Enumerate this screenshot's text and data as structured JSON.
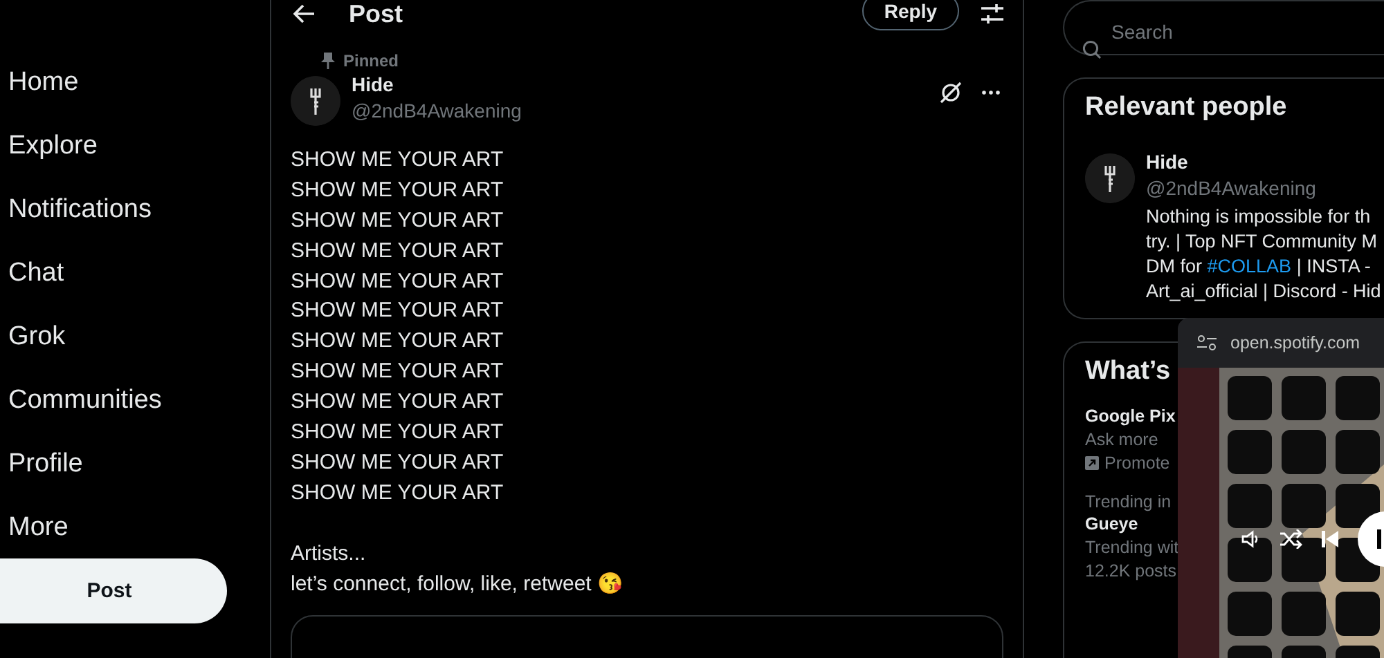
{
  "nav": {
    "items": [
      {
        "label": "Home"
      },
      {
        "label": "Explore"
      },
      {
        "label": "Notifications"
      },
      {
        "label": "Chat"
      },
      {
        "label": "Grok"
      },
      {
        "label": "Communities"
      },
      {
        "label": "Profile"
      },
      {
        "label": "More"
      }
    ],
    "post_button": "Post"
  },
  "header": {
    "title": "Post",
    "reply_button": "Reply"
  },
  "tweet": {
    "pinned_label": "Pinned",
    "name": "Hide",
    "handle": "@2ndB4Awakening",
    "lines": [
      "SHOW ME YOUR ART",
      "SHOW ME YOUR ART",
      "SHOW ME YOUR ART",
      "SHOW ME YOUR ART",
      "SHOW ME YOUR ART",
      "SHOW ME YOUR ART",
      "SHOW ME YOUR ART",
      "SHOW ME YOUR ART",
      "SHOW ME YOUR ART",
      "SHOW ME YOUR ART",
      "SHOW ME YOUR ART",
      "SHOW ME YOUR ART"
    ],
    "closing": [
      "Artists...",
      "let’s connect, follow, like, retweet 😘"
    ]
  },
  "search": {
    "placeholder": "Search"
  },
  "relevant_people": {
    "title": "Relevant people",
    "name": "Hide",
    "handle": "@2ndB4Awakening",
    "bio": [
      {
        "kind": "text",
        "text": "Nothing is impossible for th try. | Top NFT Community M DM for "
      },
      {
        "kind": "hashtag",
        "text": "#COLLAB"
      },
      {
        "kind": "text",
        "text": " | INSTA - Art_ai_official | Discord - Hid"
      }
    ]
  },
  "trends": {
    "title": "What’s",
    "items": [
      {
        "kind": "promoted",
        "name": "Google Pix",
        "detail": "Ask more",
        "meta": "Promote"
      },
      {
        "kind": "trend",
        "context": "Trending in",
        "name": "Gueye",
        "detail": "Trending wit",
        "meta": "12.2K posts"
      }
    ]
  },
  "mini_player": {
    "url": "open.spotify.com"
  }
}
